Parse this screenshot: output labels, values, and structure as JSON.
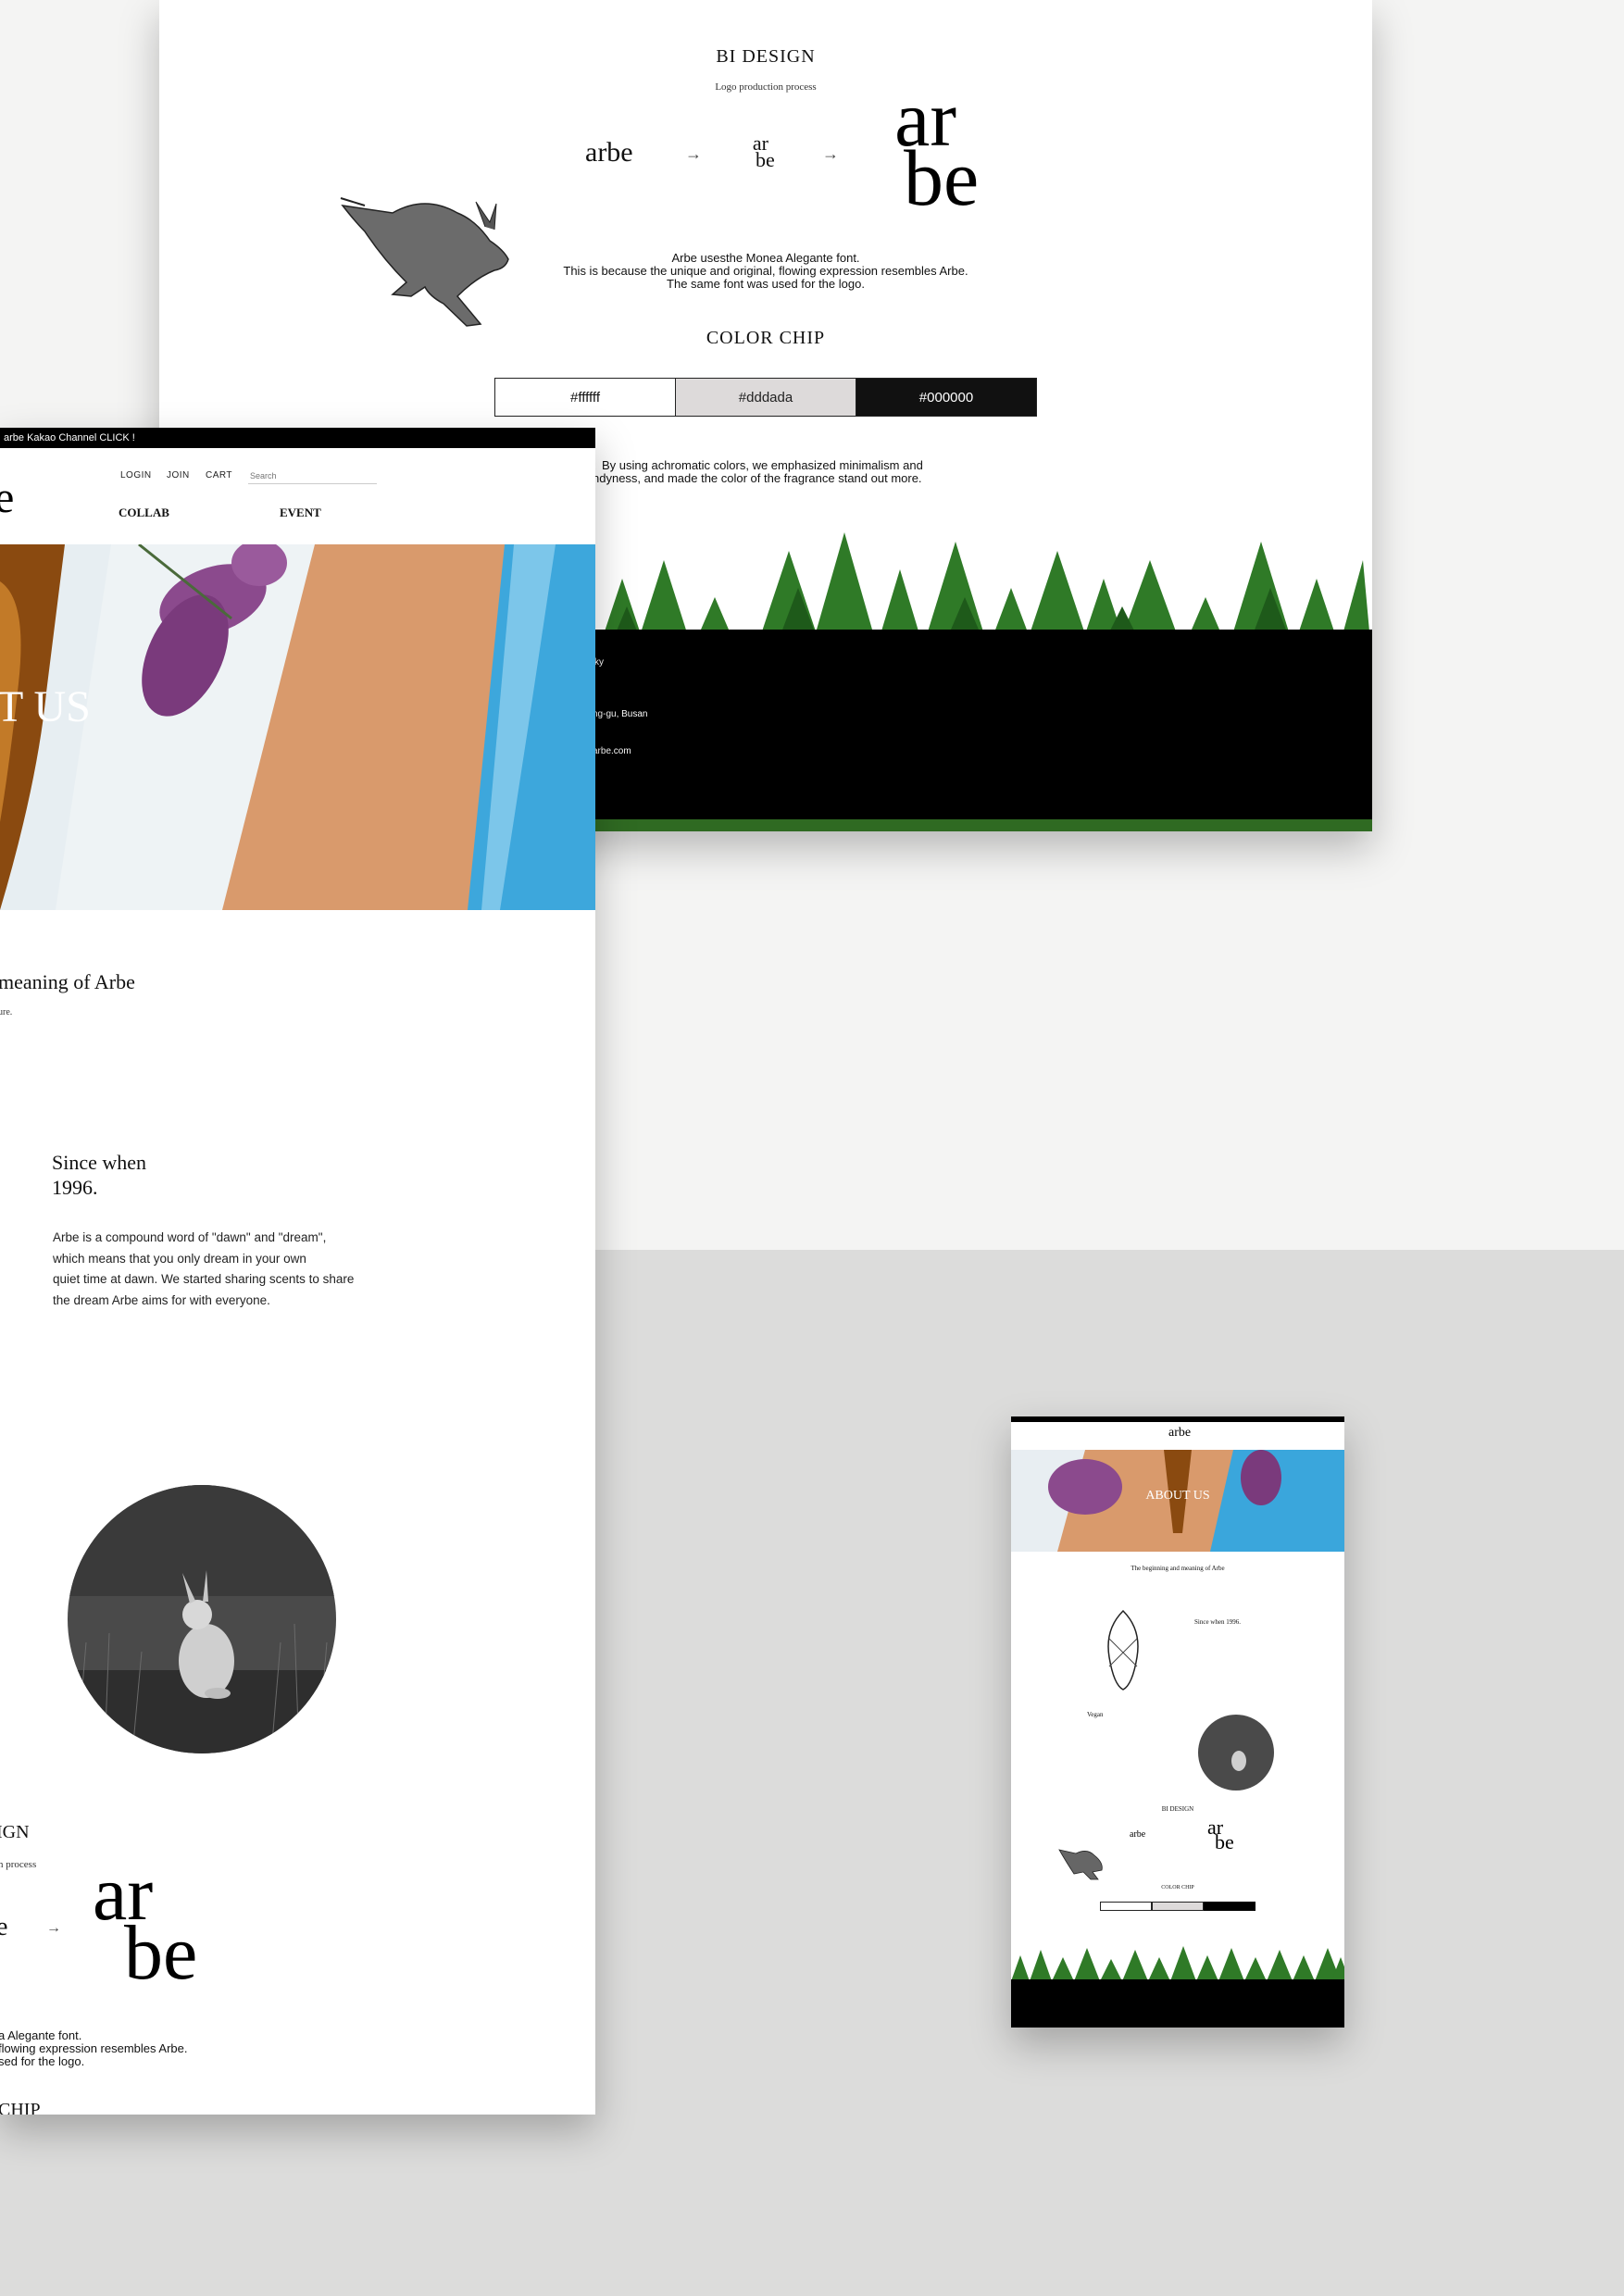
{
  "colors": {
    "white": "#ffffff",
    "gray": "#dddada",
    "black": "#000000"
  },
  "bi": {
    "title": "BI DESIGN",
    "subtitle": "Logo production process",
    "logo_small": "arbe",
    "arrow": "→",
    "logo_stacked_top": "ar",
    "logo_stacked_bottom": "be",
    "logo_big_top": "ar",
    "logo_big_bottom": "be",
    "desc_line1": "Arbe usesthe Monea Alegante font.",
    "desc_line2": "This is because the unique and original, flowing expression resembles Arbe.",
    "desc_line3": "The same font was used for the logo."
  },
  "color_chip": {
    "title": "COLOR CHIP",
    "chips": [
      "#ffffff",
      "#dddada",
      "#000000"
    ],
    "desc_line1": "By using achromatic colors, we emphasized minimalism and",
    "desc_line2": "ndyness, and made the color of the fragrance stand out more."
  },
  "footer": {
    "line1": "ky",
    "line2": "ng-gu, Busan",
    "line3": "arbe.com"
  },
  "site": {
    "topbar_text": "arbe Kakao Channel CLICK !",
    "logo_fragment": "e",
    "nav": {
      "login": "LOGIN",
      "join": "JOIN",
      "cart": "CART",
      "search_placeholder": "Search"
    },
    "menu": {
      "collab": "COLLAB",
      "event": "EVENT"
    },
    "hero_title": "T US",
    "meaning_title": "meaning of Arbe",
    "meaning_sub": "ure.",
    "since_title_line1": "Since when",
    "since_title_line2": "1996.",
    "since_body": [
      "Arbe is a compound word of \"dawn\" and \"dream\",",
      "which means that you only dream in your own",
      "quiet time at dawn. We started sharing scents to share",
      "the dream Arbe aims for with everyone."
    ],
    "bi_title_fragment": "IGN",
    "bi_sub_fragment": "n process",
    "bi_logo_fragment": "e",
    "arrow": "→",
    "bi_desc_fragment": [
      "a Alegante font.",
      "flowing expression resembles Arbe.",
      "sed for the logo."
    ],
    "chip_fragment": "CHIP"
  },
  "small": {
    "hero_title": "ABOUT US",
    "meaning_title": "The beginning and meaning of Arbe",
    "since_title": "Since when 1996.",
    "vegan_title": "Vegan",
    "bi_title": "BI DESIGN",
    "chip_title": "COLOR CHIP"
  }
}
